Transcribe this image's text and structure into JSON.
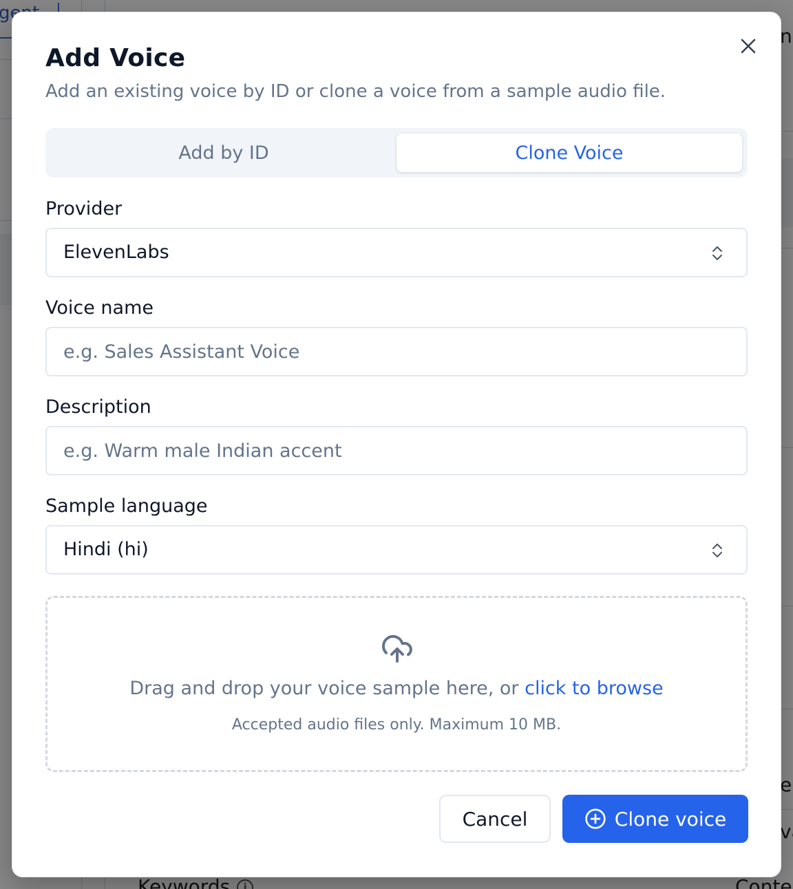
{
  "background": {
    "tab_fragment": "gent",
    "right_fragments": [
      "nc",
      "el",
      "va"
    ],
    "bottom_left_label": "Keywords",
    "bottom_right_label": "Conte"
  },
  "dialog": {
    "title": "Add Voice",
    "subtitle": "Add an existing voice by ID or clone a voice from a sample audio file.",
    "close_icon": "close-icon",
    "tabs": [
      {
        "label": "Add by ID",
        "active": false
      },
      {
        "label": "Clone Voice",
        "active": true
      }
    ],
    "provider": {
      "label": "Provider",
      "value": "ElevenLabs",
      "icon": "chevrons-up-down-icon"
    },
    "voice_name": {
      "label": "Voice name",
      "value": "",
      "placeholder": "e.g. Sales Assistant Voice"
    },
    "description": {
      "label": "Description",
      "value": "",
      "placeholder": "e.g. Warm male Indian accent"
    },
    "sample_language": {
      "label": "Sample language",
      "value": "Hindi (hi)",
      "icon": "chevrons-up-down-icon"
    },
    "dropzone": {
      "icon": "upload-cloud-icon",
      "text": "Drag and drop your voice sample here, or ",
      "link": "click to browse",
      "hint": "Accepted audio files only. Maximum 10 MB."
    },
    "actions": {
      "cancel_label": "Cancel",
      "primary_label": "Clone voice",
      "primary_icon": "plus-circle-icon"
    }
  },
  "colors": {
    "accent": "#2563eb",
    "muted_text": "#64748b",
    "heading": "#0f172a",
    "border": "#e2e8f0",
    "tab_track": "#f1f5f9"
  }
}
